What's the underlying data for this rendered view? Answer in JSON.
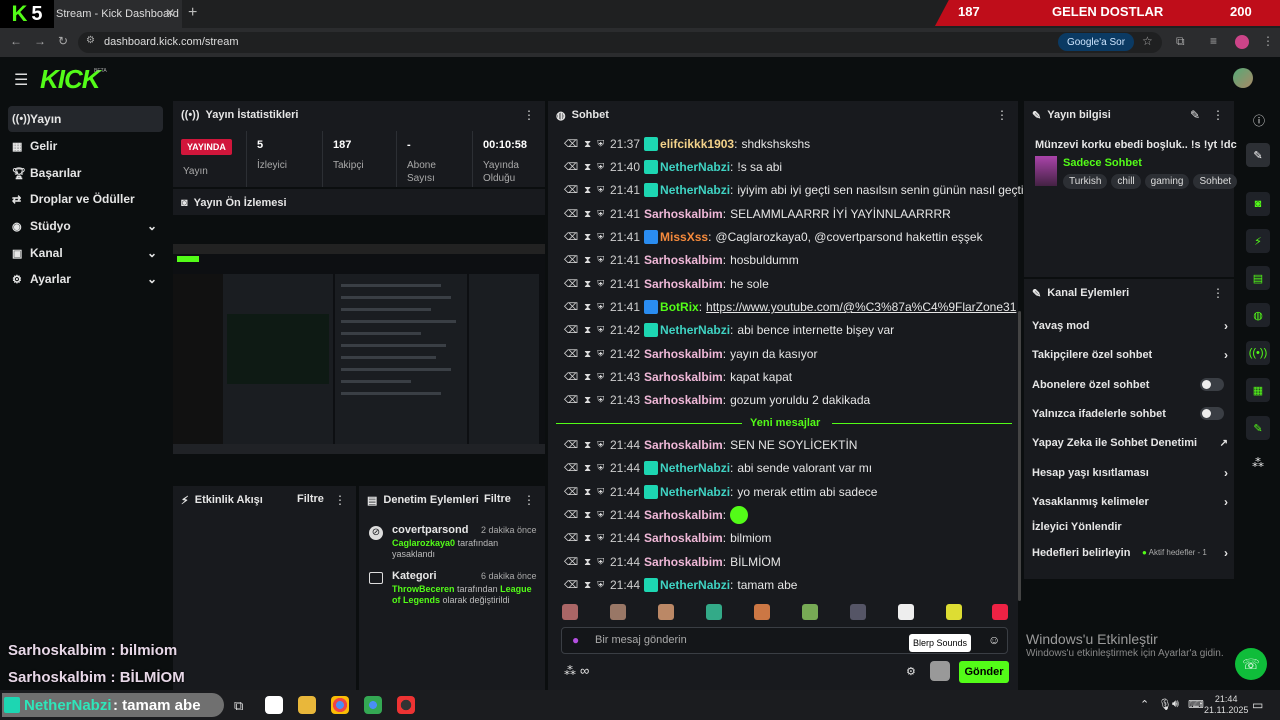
{
  "browser": {
    "tab_title": "Stream - Kick Dashboard",
    "url": "dashboard.kick.com/stream",
    "google_btn": "Google'a Sor",
    "overlay_left": "187",
    "overlay_mid": "GELEN DOSTLAR",
    "overlay_right": "200",
    "tab_number": "5"
  },
  "app": {
    "logo": "KICK",
    "beta": "BETA"
  },
  "sidebar": {
    "items": [
      {
        "label": "Yayın",
        "icon": "broadcast-icon"
      },
      {
        "label": "Gelir",
        "icon": "revenue-icon"
      },
      {
        "label": "Başarılar",
        "icon": "trophy-icon"
      },
      {
        "label": "Droplar ve Ödüller",
        "icon": "drops-icon"
      },
      {
        "label": "Stüdyo",
        "icon": "studio-icon"
      },
      {
        "label": "Kanal",
        "icon": "channel-icon"
      },
      {
        "label": "Ayarlar",
        "icon": "settings-icon"
      }
    ]
  },
  "stats": {
    "title": "Yayın İstatistikleri",
    "live_badge": "YAYINDA",
    "live_label": "Yayın",
    "viewers": "5",
    "viewers_label": "İzleyici",
    "followers": "187",
    "followers_label": "Takipçi",
    "subs": "-",
    "subs_label": "Abone Sayısı",
    "uptime": "00:10:58",
    "uptime_label": "Yayında Olduğu"
  },
  "preview": {
    "title": "Yayın Ön İzlemesi"
  },
  "activity": {
    "title": "Etkinlik Akışı",
    "filter": "Filtre"
  },
  "moderation": {
    "title": "Denetim Eylemleri",
    "filter": "Filtre",
    "items": [
      {
        "user": "covertparsond",
        "time": "2 dakika önce",
        "actor": "Caglarozkaya0",
        "rest": "tarafından yasaklandı"
      },
      {
        "user": "Kategori",
        "time": "6 dakika önce",
        "actor": "ThrowBeceren",
        "mid": "tarafından",
        "target": "League of Legends",
        "rest": "olarak değiştirildi"
      }
    ]
  },
  "chat": {
    "title": "Sohbet",
    "messages": [
      {
        "time": "21:37",
        "user": "elifcikkk1903",
        "color": "#f3d28a",
        "text": "shdkshskshs",
        "badge": "#1dd6b2"
      },
      {
        "time": "21:40",
        "user": "NetherNabzi",
        "color": "#3fd3c3",
        "text": "!s sa abi",
        "badge": "#1dd6b2"
      },
      {
        "time": "21:41",
        "user": "NetherNabzi",
        "color": "#3fd3c3",
        "text": "iyiyim abi iyi geçti sen nasılsın senin günün nasıl geçti",
        "badge": "#1dd6b2"
      },
      {
        "time": "21:41",
        "user": "Sarhoskalbim",
        "color": "#f0b8d8",
        "text": "SELAMMLAARRR İYİ YAYİNNLAARRRR",
        "badge": ""
      },
      {
        "time": "21:41",
        "user": "MissXss",
        "color": "#f58a3c",
        "text": "@Caglarozkaya0, @covertparsond hakettin eşşek",
        "badge": "#2a8cf0"
      },
      {
        "time": "21:41",
        "user": "Sarhoskalbim",
        "color": "#f0b8d8",
        "text": "hosbuldumm",
        "badge": ""
      },
      {
        "time": "21:41",
        "user": "Sarhoskalbim",
        "color": "#f0b8d8",
        "text": "he sole",
        "badge": ""
      },
      {
        "time": "21:41",
        "user": "BotRix",
        "color": "#53fc18",
        "text": "https://www.youtube.com/@%C3%87a%C4%9FlarZone31",
        "badge": "#2a8cf0"
      },
      {
        "time": "21:42",
        "user": "NetherNabzi",
        "color": "#3fd3c3",
        "text": "abi bence internette bişey var",
        "badge": "#1dd6b2"
      },
      {
        "time": "21:42",
        "user": "Sarhoskalbim",
        "color": "#f0b8d8",
        "text": "yayın da kasıyor",
        "badge": ""
      },
      {
        "time": "21:43",
        "user": "Sarhoskalbim",
        "color": "#f0b8d8",
        "text": "kapat kapat",
        "badge": ""
      },
      {
        "time": "21:43",
        "user": "Sarhoskalbim",
        "color": "#f0b8d8",
        "text": "gozum yoruldu 2 dakikada",
        "badge": ""
      },
      {
        "time": "21:44",
        "user": "Sarhoskalbim",
        "color": "#f0b8d8",
        "text": "SEN NE SOYLİCEKTİN",
        "badge": ""
      },
      {
        "time": "21:44",
        "user": "NetherNabzi",
        "color": "#3fd3c3",
        "text": "abi sende valorant var mı",
        "badge": "#1dd6b2"
      },
      {
        "time": "21:44",
        "user": "NetherNabzi",
        "color": "#3fd3c3",
        "text": "yo merak ettim abi sadece",
        "badge": "#1dd6b2"
      },
      {
        "time": "21:44",
        "user": "Sarhoskalbim",
        "color": "#f0b8d8",
        "text": "",
        "badge": ""
      },
      {
        "time": "21:44",
        "user": "Sarhoskalbim",
        "color": "#f0b8d8",
        "text": "bilmiom",
        "badge": ""
      },
      {
        "time": "21:44",
        "user": "Sarhoskalbim",
        "color": "#f0b8d8",
        "text": "BİLMİOM",
        "badge": ""
      },
      {
        "time": "21:44",
        "user": "NetherNabzi",
        "color": "#3fd3c3",
        "text": "tamam abe",
        "badge": "#1dd6b2"
      }
    ],
    "new_messages": "Yeni mesajlar",
    "placeholder": "Bir mesaj gönderin",
    "tooltip": "Blerp Sounds",
    "send": "Gönder"
  },
  "streaminfo": {
    "title": "Yayın bilgisi",
    "stream_title": "Münzevi korku ebedi boşluk.. !s !yt !dc",
    "category": "Sadece Sohbet",
    "tags": [
      "Turkish",
      "chill",
      "gaming",
      "Sohbet"
    ]
  },
  "channel_actions": {
    "title": "Kanal Eylemleri",
    "items": [
      {
        "label": "Yavaş mod",
        "type": "arrow"
      },
      {
        "label": "Takipçilere özel sohbet",
        "type": "arrow"
      },
      {
        "label": "Abonelere özel sohbet",
        "type": "toggle"
      },
      {
        "label": "Yalnızca ifadelerle sohbet",
        "type": "toggle"
      },
      {
        "label": "Yapay Zeka ile Sohbet Denetimi",
        "type": "ext"
      },
      {
        "label": "Hesap yaşı kısıtlaması",
        "type": "arrow"
      },
      {
        "label": "Yasaklanmış kelimeler",
        "type": "arrow"
      },
      {
        "label": "İzleyici Yönlendir",
        "type": "none"
      },
      {
        "label": "Hedefleri belirleyin",
        "type": "goal"
      }
    ],
    "goal_status": "Aktif hedefler - 1"
  },
  "overlay": {
    "line1": "Sarhoskalbim : bilmiom",
    "line2": "Sarhoskalbim : BİLMİOM",
    "line3_user": "NetherNabzi",
    "line3_text": ": tamam abe"
  },
  "windows": {
    "activate": "Windows'u Etkinleştir",
    "activate_sub": "Windows'u etkinleştirmek için Ayarlar'a gidin.",
    "time": "21:44",
    "date": "21.11.2025"
  }
}
